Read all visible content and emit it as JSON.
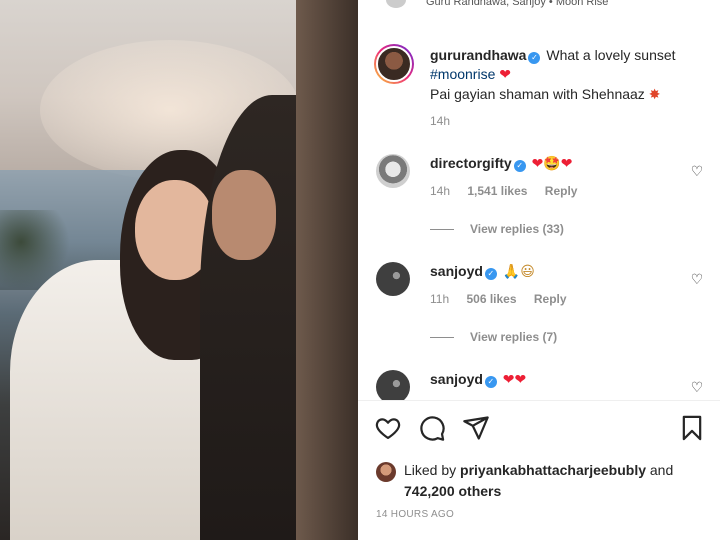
{
  "post": {
    "location_line": "Guru Randhawa, Sanjoy • Moon Rise"
  },
  "caption": {
    "username": "gururandhawa",
    "text_part1": "What a lovely sunset",
    "hashtag": "#moonrise",
    "text_part2": "Pai gayian shaman with Shehnaaz",
    "time": "14h"
  },
  "comments": [
    {
      "username": "directorgifty",
      "emojis": "❤🤩❤",
      "time": "14h",
      "likes": "1,541 likes",
      "reply_label": "Reply",
      "view_replies": "View replies (33)"
    },
    {
      "username": "sanjoyd",
      "emojis": "🙏😃",
      "time": "11h",
      "likes": "506 likes",
      "reply_label": "Reply",
      "view_replies": "View replies (7)"
    },
    {
      "username": "sanjoyd",
      "emojis": "❤❤"
    }
  ],
  "actions": {
    "like_icon": "heart-outline-icon",
    "comment_icon": "comment-icon",
    "share_icon": "paper-plane-icon",
    "save_icon": "bookmark-icon"
  },
  "liked_by": {
    "prefix": "Liked by",
    "user": "priyankabhattacharjeebubly",
    "connector": "and",
    "others": "742,200 others"
  },
  "timestamp": "14 HOURS AGO",
  "colors": {
    "verified": "#3897f0",
    "hashtag": "#00376b",
    "heart": "#ed1f35",
    "muted": "#8e8e8e"
  }
}
